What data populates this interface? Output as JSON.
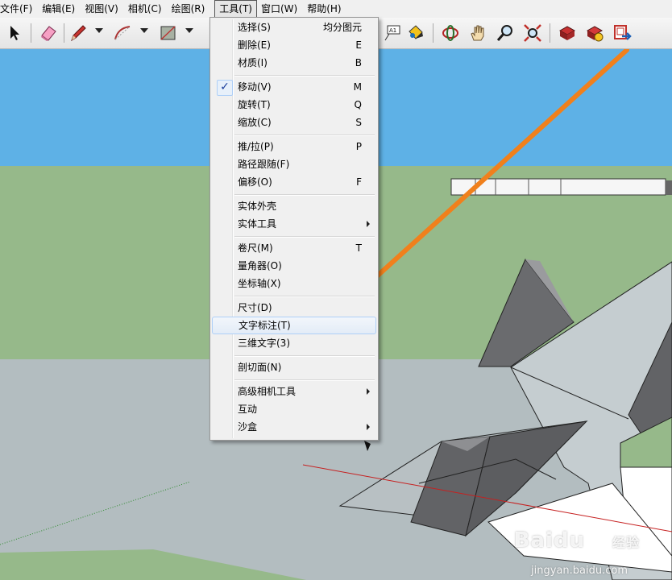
{
  "menubar": {
    "items": [
      "文件(F)",
      "编辑(E)",
      "视图(V)",
      "相机(C)",
      "绘图(R)",
      "工具(T)",
      "窗口(W)",
      "帮助(H)"
    ],
    "active_index": 5
  },
  "toolbar": {
    "left_icons": [
      "select-arrow-icon",
      "eraser-icon",
      "pencil-icon",
      "arc-icon",
      "rectangle-icon"
    ],
    "right_icons": [
      "text-label-icon",
      "paint-bucket-icon",
      "orbit-icon",
      "pan-icon",
      "zoom-icon",
      "zoom-extents-icon",
      "previous-view-icon",
      "next-view-icon",
      "share-model-icon"
    ]
  },
  "tools_menu": {
    "items": [
      {
        "label": "选择(S)",
        "shortcut": "均分图元"
      },
      {
        "label": "删除(E)",
        "shortcut": "E"
      },
      {
        "label": "材质(I)",
        "shortcut": "B"
      },
      {
        "label": "移动(V)",
        "shortcut": "M",
        "checked": true
      },
      {
        "label": "旋转(T)",
        "shortcut": "Q"
      },
      {
        "label": "缩放(C)",
        "shortcut": "S"
      },
      {
        "label": "推/拉(P)",
        "shortcut": "P"
      },
      {
        "label": "路径跟随(F)",
        "shortcut": ""
      },
      {
        "label": "偏移(O)",
        "shortcut": "F"
      },
      {
        "label": "实体外壳",
        "shortcut": ""
      },
      {
        "label": "实体工具",
        "shortcut": "",
        "submenu": true
      },
      {
        "label": "卷尺(M)",
        "shortcut": "T"
      },
      {
        "label": "量角器(O)",
        "shortcut": ""
      },
      {
        "label": "坐标轴(X)",
        "shortcut": ""
      },
      {
        "label": "尺寸(D)",
        "shortcut": ""
      },
      {
        "label": "文字标注(T)",
        "shortcut": "",
        "highlighted": true
      },
      {
        "label": "三维文字(3)",
        "shortcut": ""
      },
      {
        "label": "剖切面(N)",
        "shortcut": ""
      },
      {
        "label": "高级相机工具",
        "shortcut": "",
        "submenu": true
      },
      {
        "label": "互动",
        "shortcut": ""
      },
      {
        "label": "沙盒",
        "shortcut": "",
        "submenu": true
      }
    ]
  },
  "watermark": {
    "brand": "Baidu",
    "cn": "经验",
    "url": "jingyan.baidu.com"
  },
  "colors": {
    "sky": "#5eb1e6",
    "grass": "#96b98a",
    "ground": "#b3bdc0",
    "shape": "#626366",
    "arrow": "#f0801c",
    "highlight": "#e3ecf7"
  }
}
